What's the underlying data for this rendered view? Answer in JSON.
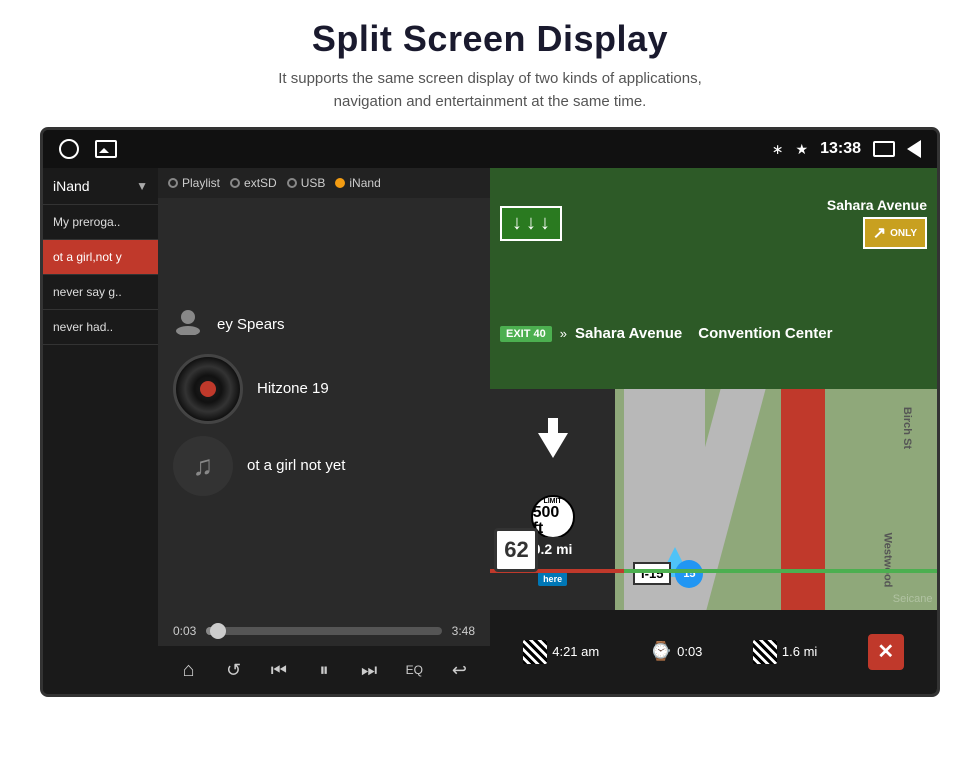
{
  "header": {
    "title": "Split Screen Display",
    "subtitle": "It supports the same screen display of two kinds of applications,\nnavigation and entertainment at the same time."
  },
  "status_bar": {
    "time": "13:38"
  },
  "music_player": {
    "source": "iNand",
    "tabs": [
      "Playlist",
      "extSD",
      "USB",
      "iNand"
    ],
    "playlist": [
      {
        "label": "My preroga..",
        "active": false
      },
      {
        "label": "ot a girl,not y",
        "active": true
      },
      {
        "label": "never say g..",
        "active": false
      },
      {
        "label": "never had..",
        "active": false
      }
    ],
    "artist": "ey Spears",
    "album": "Hitzone 19",
    "song": "ot a girl not yet",
    "time_current": "0:03",
    "time_total": "3:48",
    "controls": {
      "home": "⌂",
      "repeat": "↺",
      "prev": "⏮",
      "play": "⏸",
      "next": "⏭",
      "eq": "EQ",
      "back": "↩"
    }
  },
  "navigation": {
    "exit_label": "EXIT 40",
    "road_name": "Sahara Avenue",
    "destination": "Convention Center",
    "only_label": "ONLY",
    "distance": "0.2 mi",
    "speed": "62",
    "highway_id": "I-15",
    "highway_num": "15",
    "limit_label": "LIMIT",
    "limit_num": "500 ft",
    "here_label": "here",
    "bottom": {
      "time1": "4:21 am",
      "duration": "0:03",
      "dist": "1.6 mi"
    },
    "road_labels": {
      "birch": "Birch St",
      "west": "Westwood"
    }
  }
}
